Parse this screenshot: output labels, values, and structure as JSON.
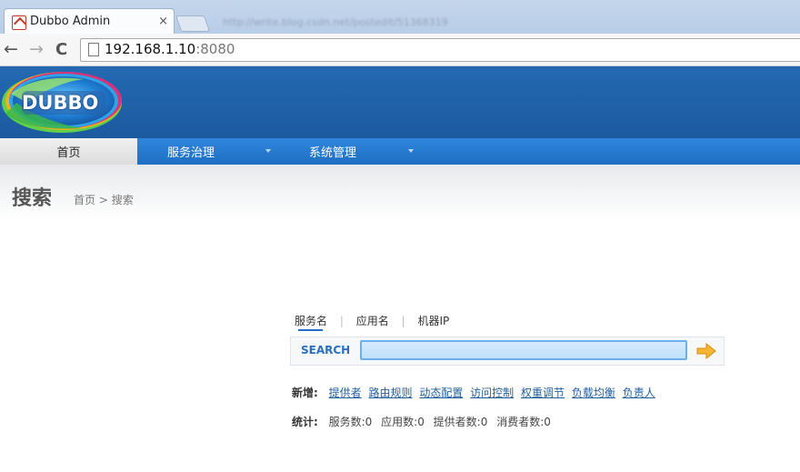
{
  "browser": {
    "tab_title": "Dubbo Admin",
    "tab_close": "×",
    "ghost_url": "http://write.blog.csdn.net/postedit/51368319",
    "back": "←",
    "forward": "→",
    "reload": "C",
    "address_host": "192.168.1.10",
    "address_port": ":8080"
  },
  "header": {
    "logo_text": "DUBBO"
  },
  "menu": [
    {
      "label": "首页",
      "active": true
    },
    {
      "label": "服务治理",
      "active": false
    },
    {
      "label": "系统管理",
      "active": false
    }
  ],
  "page": {
    "title": "搜索",
    "breadcrumb_home": "首页",
    "breadcrumb_sep": ">",
    "breadcrumb_current": "搜索"
  },
  "search": {
    "tabs": [
      "服务名",
      "应用名",
      "机器IP"
    ],
    "tab_sep": "|",
    "label": "SEARCH",
    "value": "",
    "placeholder": ""
  },
  "add": {
    "label": "新增:",
    "links": [
      "提供者",
      "路由规则",
      "动态配置",
      "访问控制",
      "权重调节",
      "负载均衡",
      "负责人"
    ]
  },
  "stats": {
    "label": "统计:",
    "items": [
      "服务数:0",
      "应用数:0",
      "提供者数:0",
      "消费者数:0"
    ]
  },
  "colors": {
    "header_bg": "#1c5a9f",
    "menu_bg": "#1f6fc4",
    "link": "#1f5f9f",
    "search_label": "#2a6fbe",
    "go_arrow": "#f5a623"
  },
  "icons": {
    "tab_favicon": "dubbo-favicon-icon",
    "page": "page-icon",
    "go": "arrow-right-icon",
    "menu_dropdown": "caret-down-icon"
  }
}
